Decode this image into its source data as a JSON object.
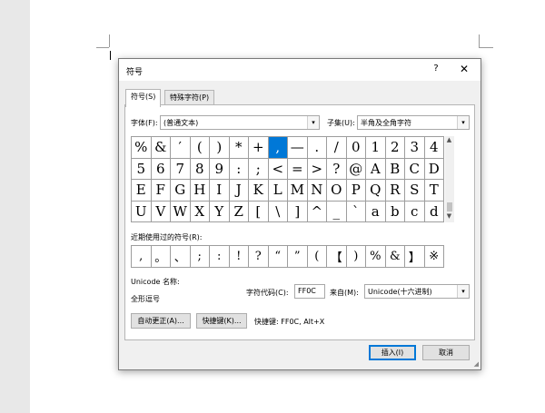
{
  "dialog": {
    "title": "符号",
    "help": "?",
    "close": "✕",
    "tabs": [
      "符号(S)",
      "特殊字符(P)"
    ],
    "font_label": "字体(F):",
    "font_value": "(普通文本)",
    "subset_label": "子集(U):",
    "subset_value": "半角及全角字符",
    "grid": [
      [
        "%",
        "&",
        "′",
        "(",
        ")",
        "*",
        "+",
        ",",
        "—",
        ".",
        "/",
        "0",
        "1",
        "2",
        "3",
        "4"
      ],
      [
        "5",
        "6",
        "7",
        "8",
        "9",
        ":",
        ";",
        "<",
        "=",
        ">",
        "?",
        "@",
        "A",
        "B",
        "C",
        "D"
      ],
      [
        "E",
        "F",
        "G",
        "H",
        "I",
        "J",
        "K",
        "L",
        "M",
        "N",
        "O",
        "P",
        "Q",
        "R",
        "S",
        "T"
      ],
      [
        "U",
        "V",
        "W",
        "X",
        "Y",
        "Z",
        "[",
        "\\",
        "]",
        "^",
        "_",
        "`",
        "a",
        "b",
        "c",
        "d"
      ]
    ],
    "recent_label": "近期使用过的符号(R):",
    "recent": [
      ",",
      "。",
      "、",
      ";",
      ":",
      "!",
      "?",
      "“",
      "”",
      "(",
      "【",
      ")",
      "%",
      "&",
      "】",
      "※"
    ],
    "unicode_name_label": "Unicode 名称:",
    "unicode_name_value": "全形逗号",
    "char_code_label": "字符代码(C):",
    "char_code_value": "FF0C",
    "from_label": "来自(M):",
    "from_value": "Unicode(十六进制)",
    "autocorrect_btn": "自动更正(A)...",
    "shortcut_btn": "快捷键(K)...",
    "shortcut_text": "快捷键: FF0C, Alt+X",
    "insert_btn": "插入(I)",
    "cancel_btn": "取消"
  },
  "colors": {
    "selection": "#0078d7",
    "dialog_bg": "#f0f0f0",
    "page_gutter": "#e8e8e8"
  }
}
